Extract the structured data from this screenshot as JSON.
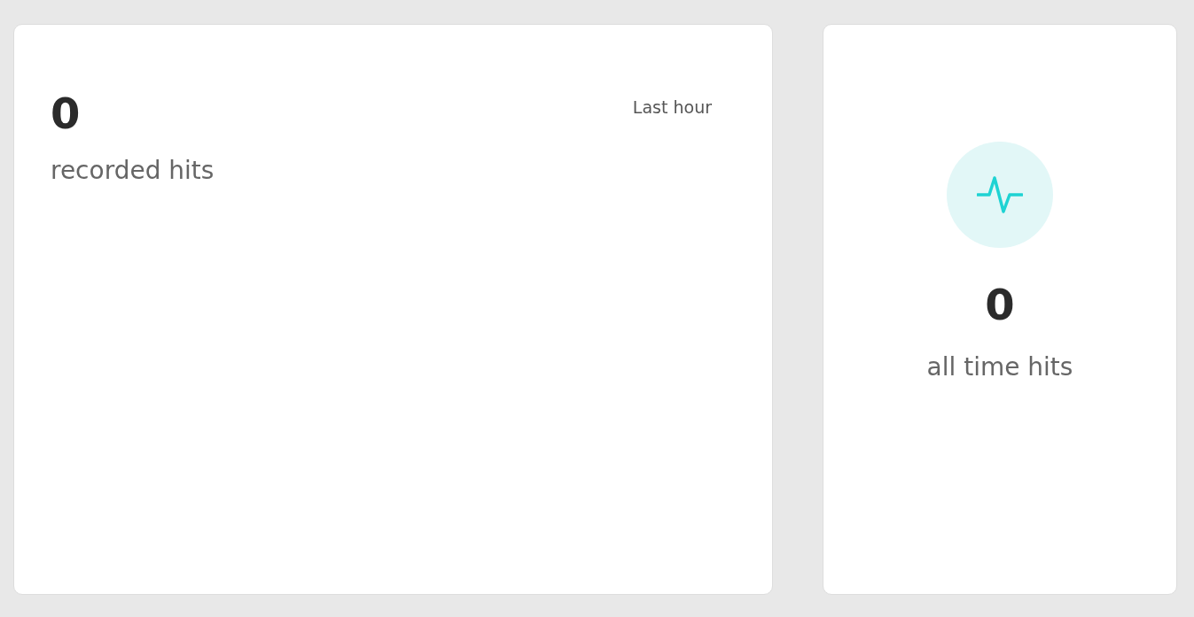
{
  "recorded": {
    "value": "0",
    "label": "recorded hits",
    "period": "Last hour"
  },
  "all_time": {
    "value": "0",
    "label": "all time hits"
  }
}
